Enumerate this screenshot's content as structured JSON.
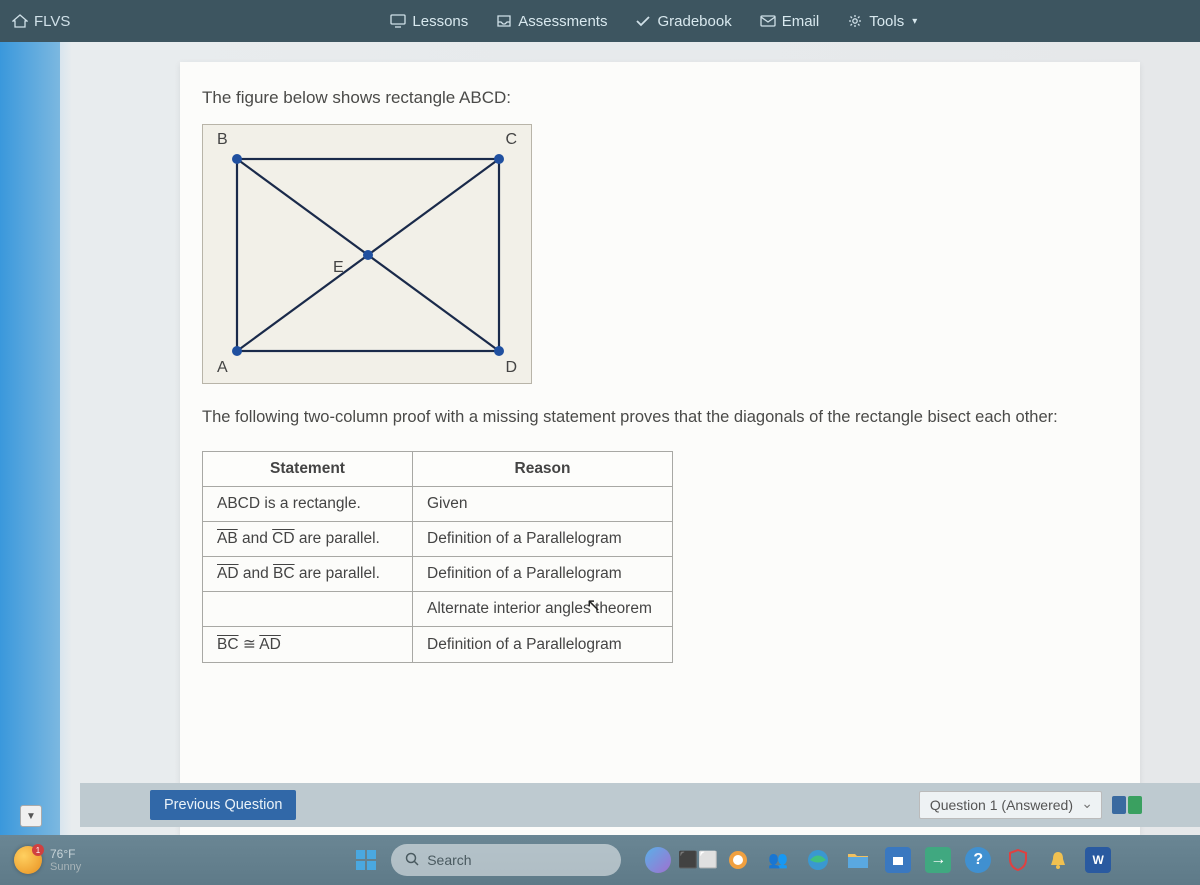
{
  "topbar": {
    "brand": "FLVS",
    "nav": {
      "lessons": "Lessons",
      "assessments": "Assessments",
      "gradebook": "Gradebook",
      "email": "Email",
      "tools": "Tools"
    }
  },
  "question": {
    "intro": "The figure below shows rectangle ABCD:",
    "labels": {
      "B": "B",
      "C": "C",
      "A": "A",
      "D": "D",
      "E": "E"
    },
    "description": "The following two-column proof with a missing statement proves that the diagonals of the rectangle bisect each other:",
    "table": {
      "headers": {
        "statement": "Statement",
        "reason": "Reason"
      },
      "rows": [
        {
          "statement_plain": "ABCD is a rectangle.",
          "reason": "Given"
        },
        {
          "seg1": "AB",
          "mid": " and ",
          "seg2": "CD",
          "tail": " are parallel.",
          "reason": "Definition of a Parallelogram"
        },
        {
          "seg1": "AD",
          "mid": " and ",
          "seg2": "BC",
          "tail": " are parallel.",
          "reason": "Definition of a Parallelogram"
        },
        {
          "statement_plain": "",
          "reason": "Alternate interior angles theorem"
        },
        {
          "seg1": "BC",
          "cong": " ≅ ",
          "seg2": "AD",
          "reason": "Definition of a Parallelogram"
        }
      ]
    }
  },
  "footer": {
    "prev": "Previous Question",
    "status": "Question 1 (Answered)"
  },
  "taskbar": {
    "temp": "76°F",
    "cond": "Sunny",
    "badge": "1",
    "search": "Search"
  }
}
